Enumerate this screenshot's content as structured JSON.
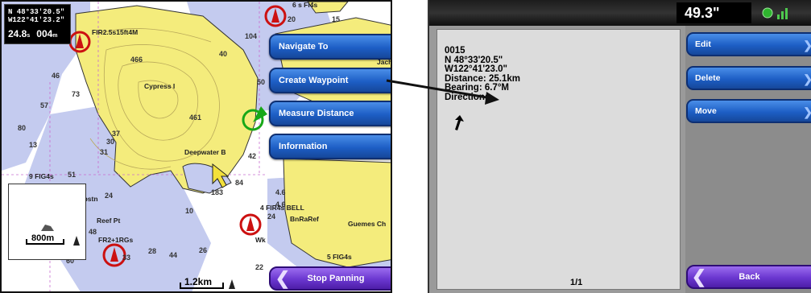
{
  "chart_screen": {
    "position": {
      "lat": "N 48°33'20.5\"",
      "lon": "W122°41'23.2\"",
      "distance": "24.8",
      "distance_unit": "s",
      "bearing": "004",
      "bearing_unit": "m"
    },
    "menu": [
      {
        "label": "Navigate To"
      },
      {
        "label": "Create Waypoint"
      },
      {
        "label": "Measure Distance"
      },
      {
        "label": "Information"
      }
    ],
    "stop_label": "Stop Panning",
    "scale_main": "1.2km",
    "scale_inset": "800m",
    "map_labels": {
      "fl_top": "6 s Fl4s",
      "fir": "FIR2.5s15ft4M",
      "cypress": "Cypress I",
      "deepwater": "Deepwater B",
      "fl9": "9 FIG4s",
      "obstn": "Obstn",
      "reef": "Reef Pt",
      "fr2": "FR2+1RGs",
      "fir4": "4 FIR4s BELL",
      "bnraref": "BnRaRef",
      "guemes": "Guemes Ch",
      "wk": "Wk",
      "fl5": "5 FIG4s",
      "jach": "Jach"
    },
    "soundings": [
      "20",
      "15",
      "104",
      "40",
      "466",
      "46",
      "73",
      "57",
      "80",
      "13",
      "51",
      "461",
      "37",
      "30",
      "31",
      "42",
      "84",
      "10",
      "4.6",
      "24",
      "26",
      "44",
      "48",
      "33",
      "22",
      "28",
      "60",
      "24",
      "183",
      "4.6",
      "50"
    ]
  },
  "waypoint_screen": {
    "speed": "49.3\"",
    "details": {
      "name": "0015",
      "lat": "N  48°33'20.5\"",
      "lon": "W122°41'23.0\"",
      "distance": "Distance: 25.1km",
      "bearing": "Bearing: 6.7°M",
      "direction": "Direction:"
    },
    "page": "1/1",
    "buttons": [
      {
        "label": "Edit"
      },
      {
        "label": "Delete"
      },
      {
        "label": "Move"
      }
    ],
    "back_label": "Back"
  },
  "colors": {
    "land": "#f4ec7c",
    "shallow_water": "#c4cbef",
    "deep_water": "#ffffff",
    "menu_blue": "#1d5ec5",
    "purple_button": "#6a36cf",
    "buoy_red": "#cc1111",
    "buoy_green": "#18a818"
  }
}
